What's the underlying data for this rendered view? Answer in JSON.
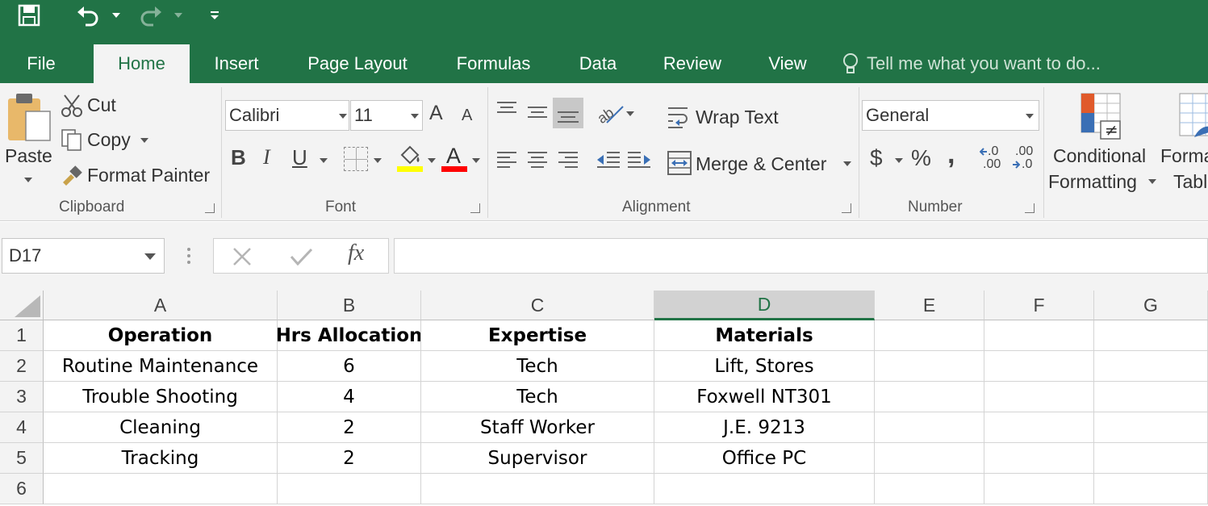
{
  "quick_access": {
    "save_icon": "save-icon",
    "undo_icon": "undo-icon",
    "redo_icon": "redo-icon",
    "customize_icon": "customize-qat-icon"
  },
  "tabs": [
    "File",
    "Home",
    "Insert",
    "Page Layout",
    "Formulas",
    "Data",
    "Review",
    "View"
  ],
  "tell_me": "Tell me what you want to do...",
  "clipboard": {
    "paste": "Paste",
    "cut": "Cut",
    "copy": "Copy",
    "format_painter": "Format Painter",
    "group": "Clipboard"
  },
  "font": {
    "name": "Calibri",
    "size": "11",
    "bold": "B",
    "italic": "I",
    "underline": "U",
    "grow": "A",
    "shrink": "A",
    "font_color_glyph": "A",
    "group": "Font",
    "highlight_color": "#ffff00",
    "font_color": "#ff0000"
  },
  "alignment": {
    "wrap_text": "Wrap Text",
    "merge_center": "Merge & Center",
    "group": "Alignment"
  },
  "number": {
    "format": "General",
    "currency": "$",
    "percent": "%",
    "comma": ",",
    "inc_dec_top": ".0",
    "inc_dec_bot": ".00",
    "dec_dec_top": ".00",
    "dec_dec_bot": ".0",
    "group": "Number"
  },
  "styles": {
    "conditional_1": "Conditional",
    "conditional_2": "Formatting",
    "format_table_1": "Forma",
    "format_table_2": "Tabl"
  },
  "formula_bar": {
    "name_box": "D17",
    "fx": "fx",
    "value": ""
  },
  "columns": [
    "A",
    "B",
    "C",
    "D",
    "E",
    "F",
    "G"
  ],
  "selected_column": "D",
  "rows": [
    "1",
    "2",
    "3",
    "4",
    "5",
    "6"
  ],
  "table": {
    "headers": [
      "Operation",
      "Hrs Allocation",
      "Expertise",
      "Materials"
    ],
    "data": [
      [
        "Routine Maintenance",
        "6",
        "Tech",
        "Lift, Stores"
      ],
      [
        "Trouble Shooting",
        "4",
        "Tech",
        "Foxwell NT301"
      ],
      [
        "Cleaning",
        "2",
        "Staff Worker",
        "J.E. 9213"
      ],
      [
        "Tracking",
        "2",
        "Supervisor",
        "Office PC"
      ]
    ]
  },
  "colors": {
    "accent": "#217346",
    "ribbon_bg": "#f3f3f3"
  }
}
